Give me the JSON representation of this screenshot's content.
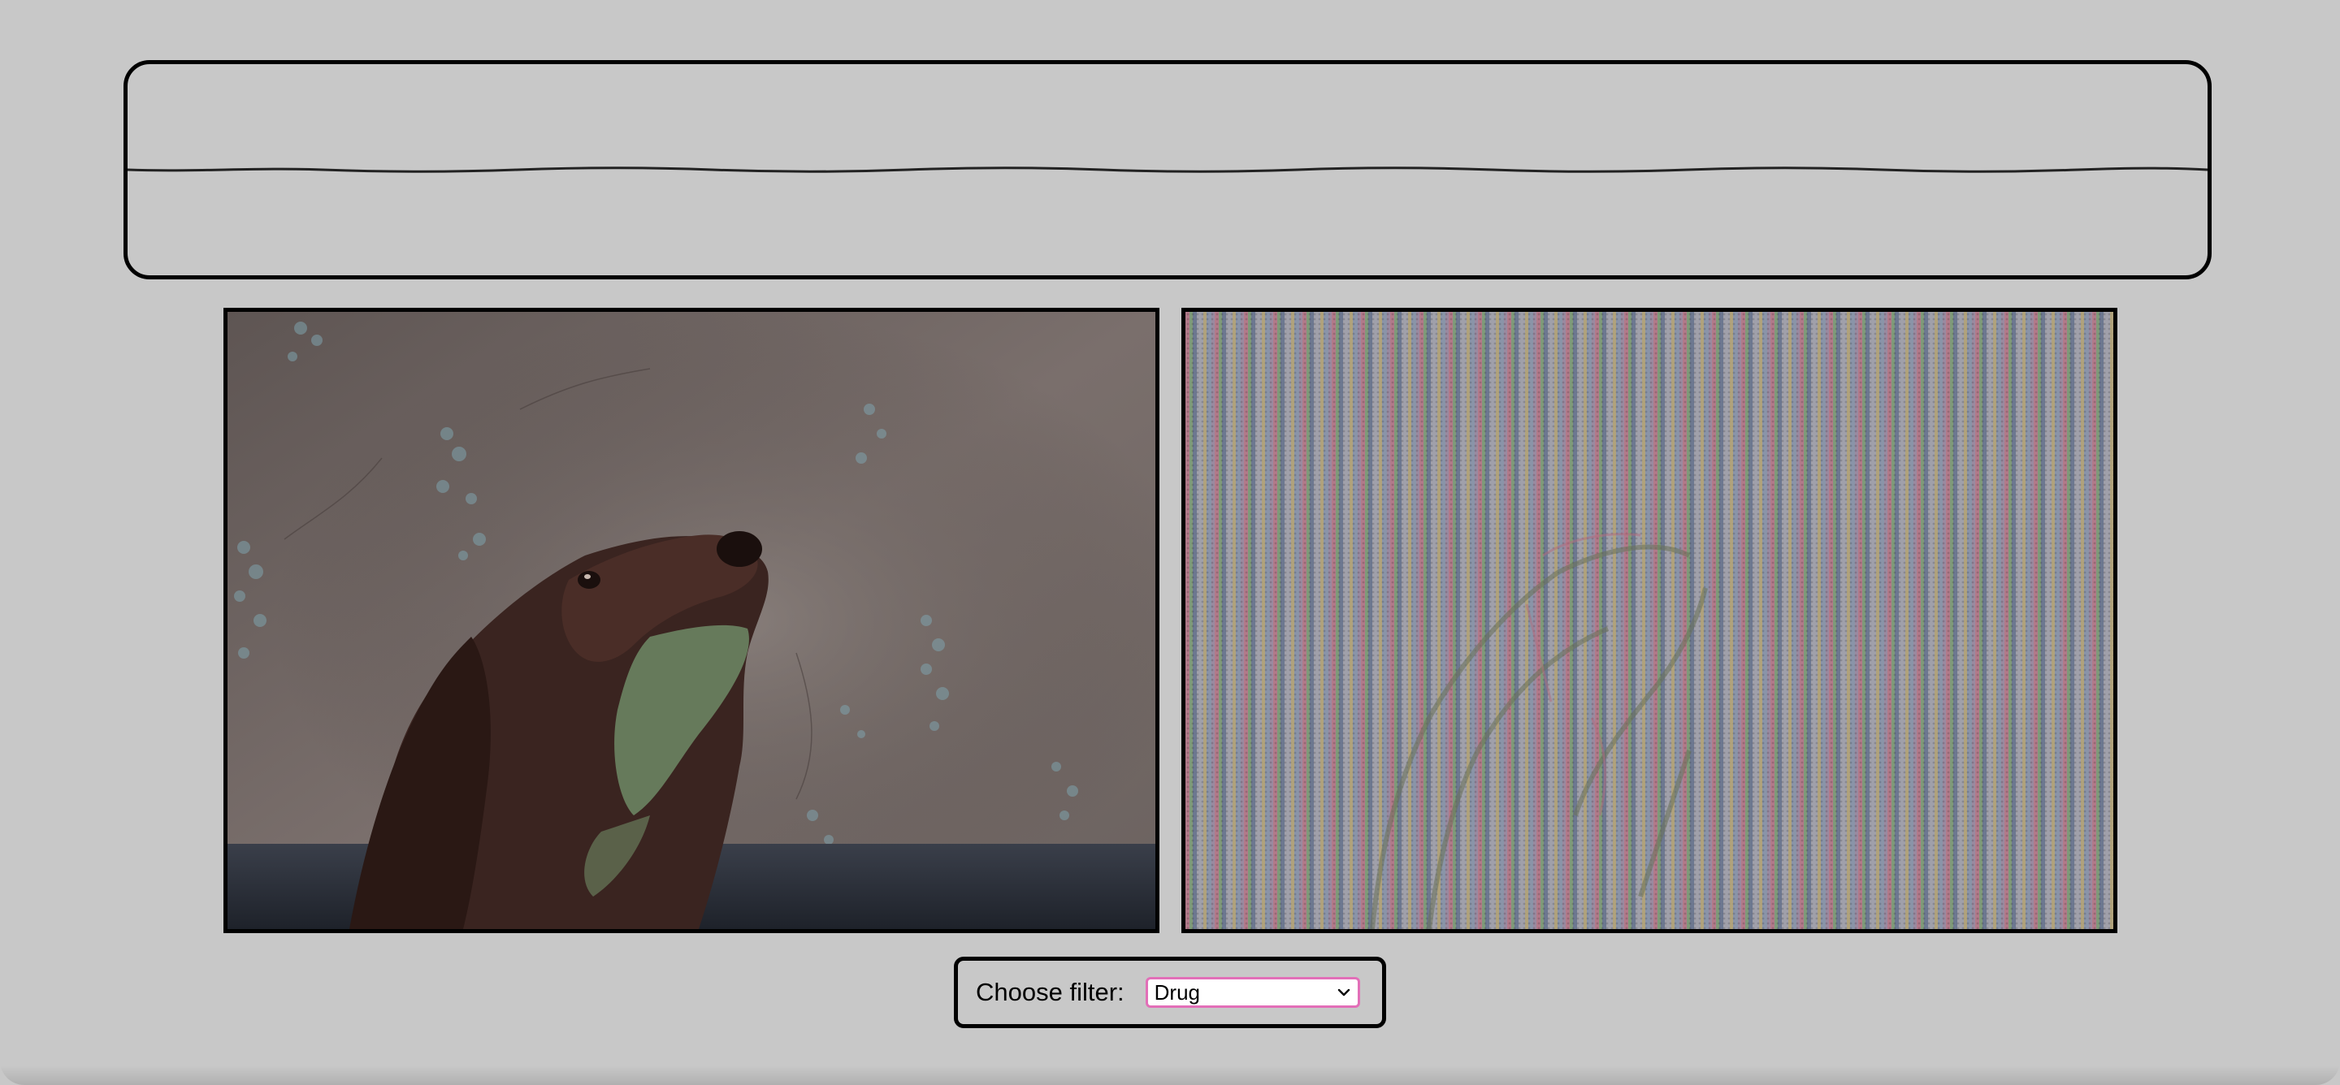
{
  "header": {
    "title": "",
    "subtitle": ""
  },
  "videos": {
    "original_name": "original-webcam-feed",
    "filtered_name": "filtered-webcam-feed"
  },
  "controls": {
    "filter_label": "Choose filter:",
    "selected_filter": "Drug",
    "accent_color": "#e26fb8"
  },
  "colors": {
    "background": "#c8c8c8",
    "border": "#000000"
  }
}
